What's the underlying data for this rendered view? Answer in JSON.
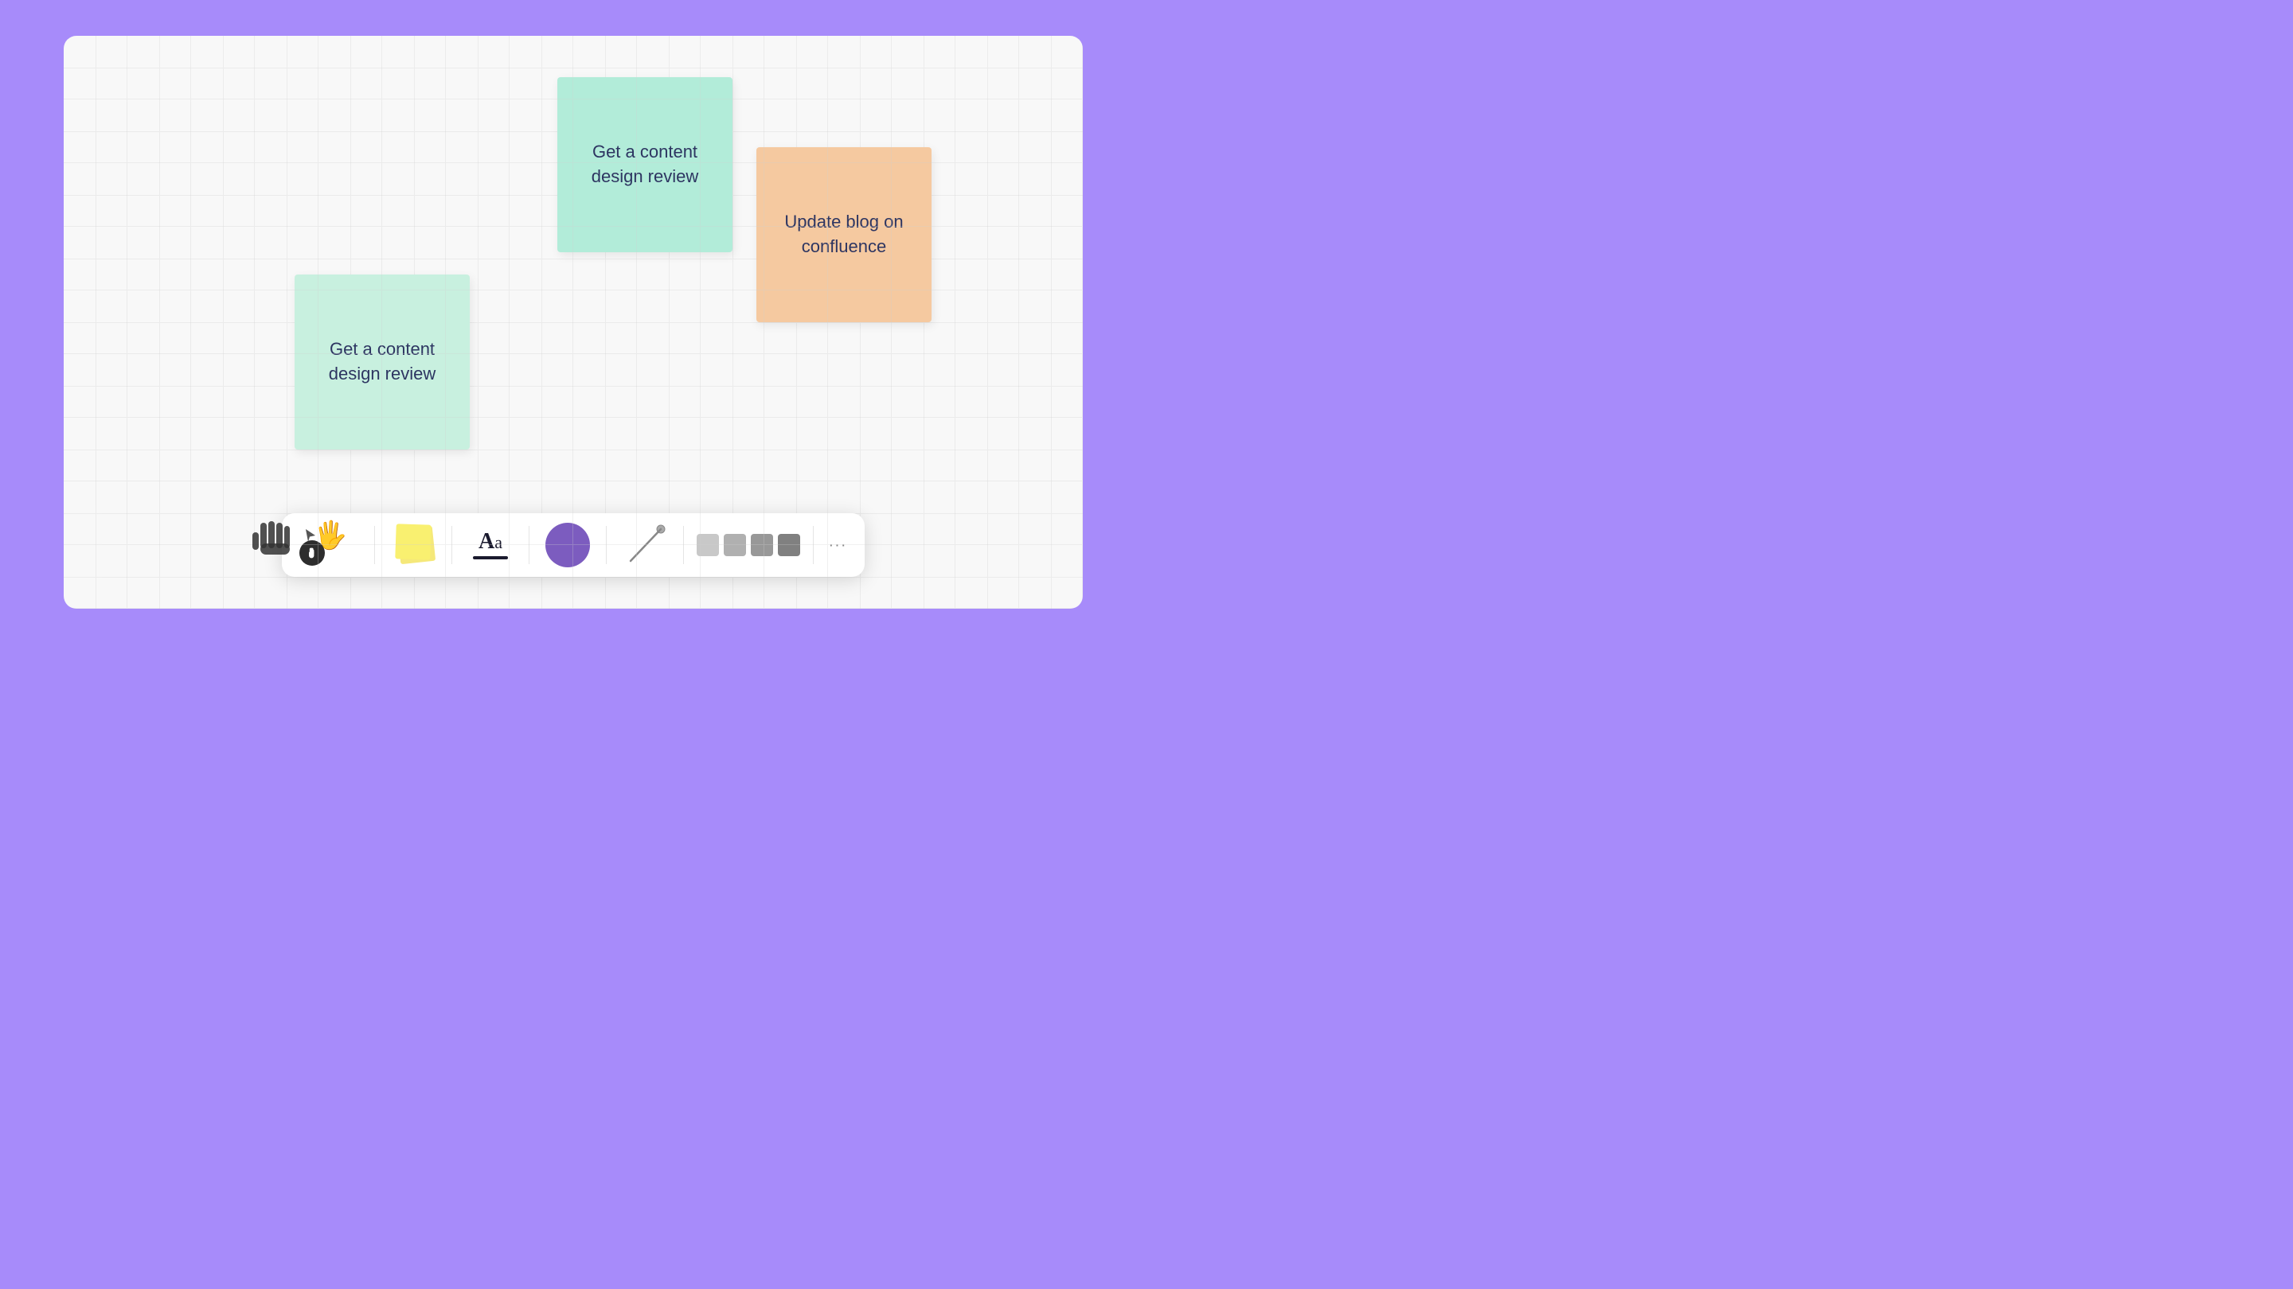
{
  "canvas": {
    "background": "#f8f8f8"
  },
  "sticky_notes": [
    {
      "id": "note-green-large",
      "text": "Get a content design review",
      "color": "#b2ecd9",
      "position": "top-center"
    },
    {
      "id": "note-peach",
      "text": "Update blog on confluence",
      "color": "#f5c9a0",
      "position": "top-right"
    },
    {
      "id": "note-green-small",
      "text": "Get a content design review",
      "color": "#c8f0df",
      "position": "middle-left"
    }
  ],
  "toolbar": {
    "tools": [
      {
        "id": "select",
        "label": "Select"
      },
      {
        "id": "hand",
        "label": "Hand"
      },
      {
        "id": "sticky",
        "label": "Sticky Note"
      },
      {
        "id": "text",
        "label": "Aa"
      },
      {
        "id": "shape",
        "label": "Shape"
      },
      {
        "id": "line",
        "label": "Line"
      }
    ],
    "colors": [
      {
        "id": "swatch-1",
        "color": "#d0d0d0"
      },
      {
        "id": "swatch-2",
        "color": "#b0b0b0"
      },
      {
        "id": "swatch-3",
        "color": "#909090"
      },
      {
        "id": "swatch-4",
        "color": "#707070"
      }
    ],
    "more_label": "···"
  }
}
